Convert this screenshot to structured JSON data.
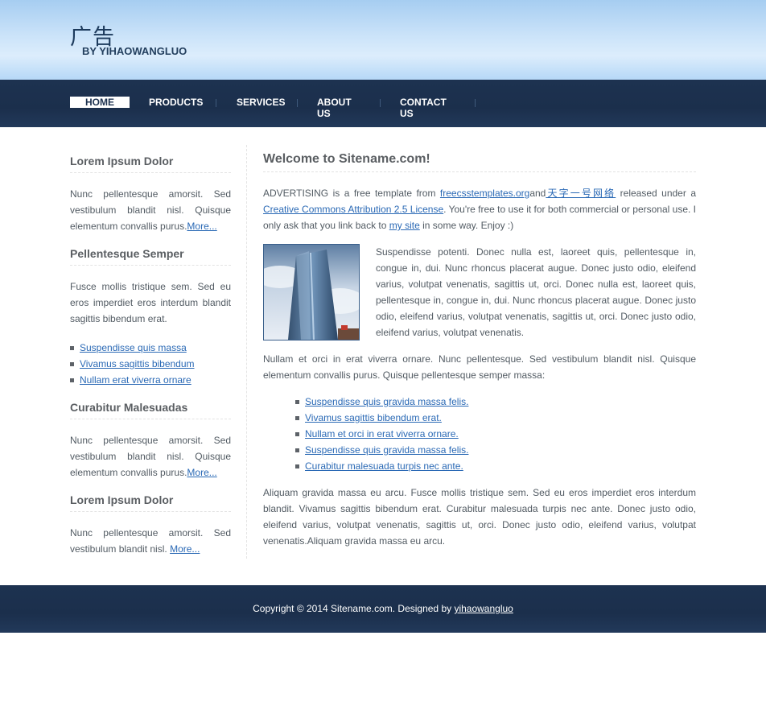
{
  "header": {
    "title": "广告",
    "subtitle": "BY YIHAOWANGLUO"
  },
  "nav": {
    "items": [
      {
        "label": "HOME",
        "active": true
      },
      {
        "label": "PRODUCTS",
        "active": false
      },
      {
        "label": "SERVICES",
        "active": false
      },
      {
        "label": "ABOUT US",
        "active": false
      },
      {
        "label": "CONTACT US",
        "active": false
      }
    ]
  },
  "sidebar": {
    "blocks": [
      {
        "title": "Lorem Ipsum Dolor",
        "text": "Nunc pellentesque amorsit. Sed vestibulum blandit nisl. Quisque elementum convallis purus.",
        "more": "More..."
      },
      {
        "title": "Pellentesque Semper",
        "text": "Fusce mollis tristique sem. Sed eu eros imperdiet eros interdum blandit sagittis bibendum erat.",
        "links": [
          "Suspendisse quis massa",
          "Vivamus sagittis bibendum",
          "Nullam erat viverra ornare"
        ]
      },
      {
        "title": "Curabitur Malesuadas",
        "text": "Nunc pellentesque amorsit. Sed vestibulum blandit nisl. Quisque elementum convallis purus.",
        "more": "More..."
      },
      {
        "title": "Lorem Ipsum Dolor",
        "text": "Nunc pellentesque amorsit. Sed vestibulum blandit nisl.",
        "more": "More..."
      }
    ]
  },
  "main": {
    "title": "Welcome to Sitename.com!",
    "intro": {
      "t1": "ADVERTISING is a free template from ",
      "link1": "freecsstemplates.org",
      "t2": "and",
      "link2": "天字一号网络",
      "t3": " released under a ",
      "link3": "Creative Commons Attribution 2.5 License",
      "t4": ". You're free to use it for both commercial or personal use. I only ask that you link back to ",
      "link4": "my site",
      "t5": " in some way. Enjoy :)"
    },
    "image_alt": "office tower photo",
    "para2": "Suspendisse potenti. Donec nulla est, laoreet quis, pellentesque in, congue in, dui. Nunc rhoncus placerat augue. Donec justo odio, eleifend varius, volutpat venenatis, sagittis ut, orci. Donec nulla est, laoreet quis, pellentesque in, congue in, dui. Nunc rhoncus placerat augue. Donec justo odio, eleifend varius, volutpat venenatis, sagittis ut, orci. Donec justo odio, eleifend varius, volutpat venenatis.",
    "para3": "Nullam et orci in erat viverra ornare. Nunc pellentesque. Sed vestibulum blandit nisl. Quisque elementum convallis purus. Quisque pellentesque semper massa:",
    "links": [
      "Suspendisse quis gravida massa felis.",
      "Vivamus sagittis bibendum erat.",
      "Nullam et orci in erat viverra ornare.",
      "Suspendisse quis gravida massa felis.",
      "Curabitur malesuada turpis nec ante."
    ],
    "para4": "Aliquam gravida massa eu arcu. Fusce mollis tristique sem. Sed eu eros imperdiet eros interdum blandit. Vivamus sagittis bibendum erat. Curabitur malesuada turpis nec ante. Donec justo odio, eleifend varius, volutpat venenatis, sagittis ut, orci. Donec justo odio, eleifend varius, volutpat venenatis.Aliquam gravida massa eu arcu."
  },
  "footer": {
    "text": "Copyright © 2014 Sitename.com. Designed by ",
    "link": "yihaowangluo"
  },
  "colors": {
    "nav_bg": "#1d3250",
    "link": "#2a69b5",
    "header_sky": "#a6cdf1"
  }
}
